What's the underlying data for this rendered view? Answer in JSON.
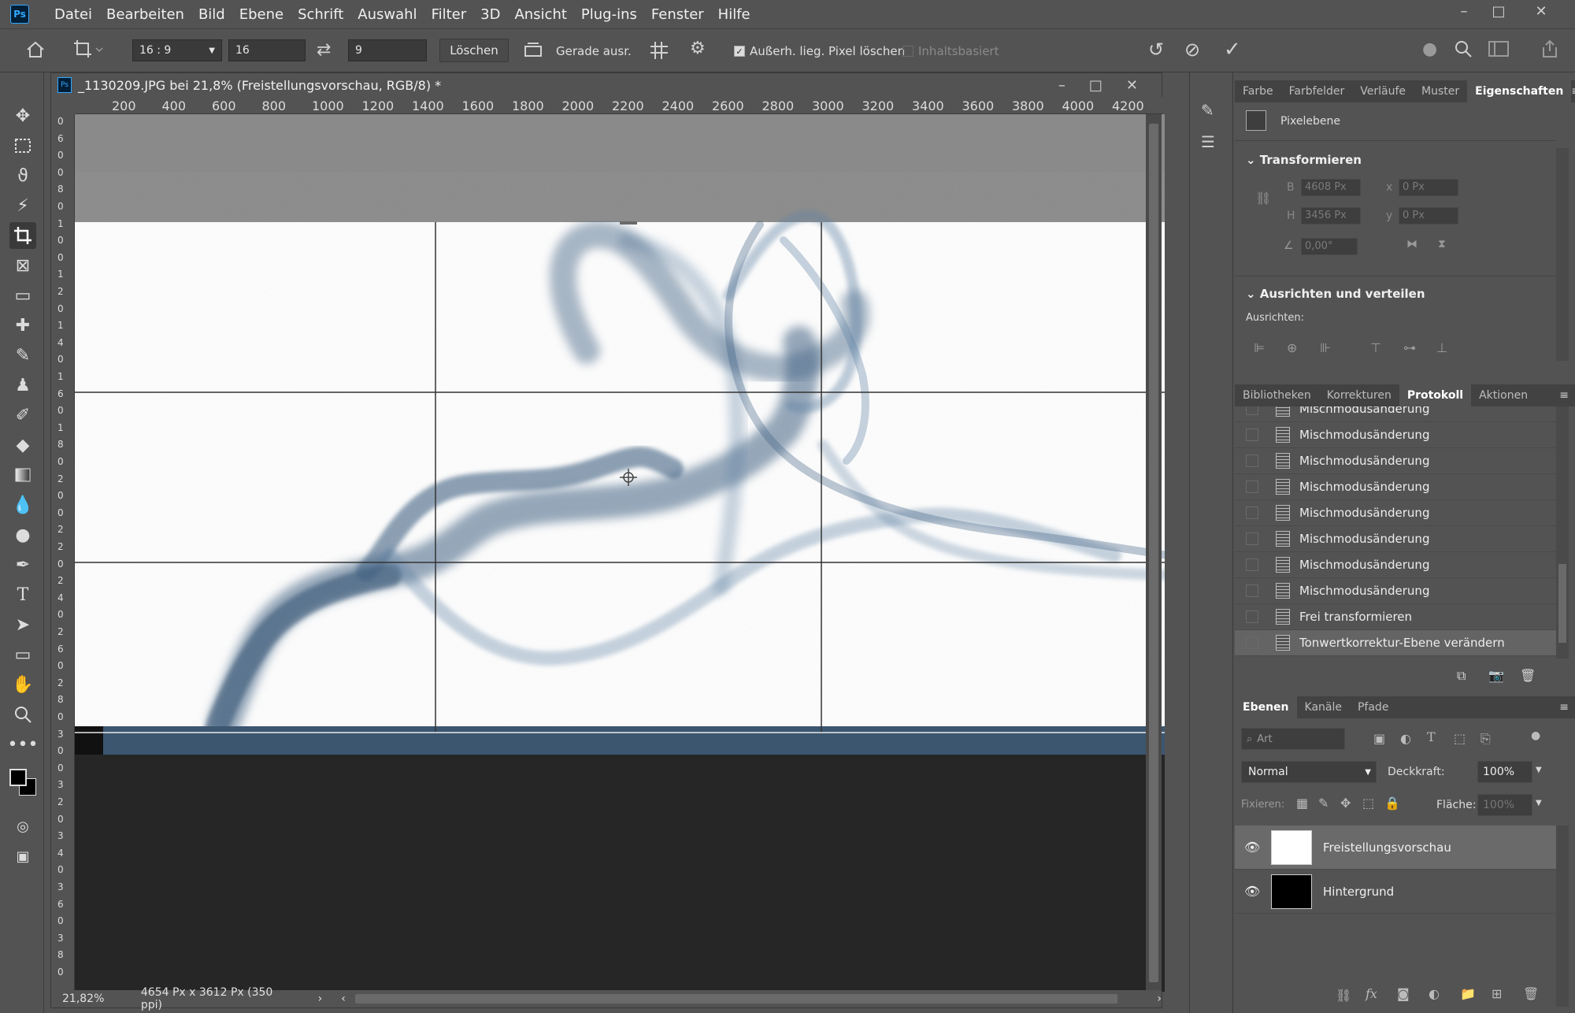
{
  "app": {
    "logo": "Ps"
  },
  "menu": [
    "Datei",
    "Bearbeiten",
    "Bild",
    "Ebene",
    "Schrift",
    "Auswahl",
    "Filter",
    "3D",
    "Ansicht",
    "Plug-ins",
    "Fenster",
    "Hilfe"
  ],
  "window_controls": {
    "minimize": "–",
    "maximize": "□",
    "close": "✕"
  },
  "options": {
    "ratio_select": "16 : 9",
    "width_value": "16",
    "height_value": "9",
    "clear_label": "Löschen",
    "straighten_label": "Gerade ausr.",
    "delete_cropped_label": "Außerh. lieg. Pixel löschen",
    "delete_cropped_checked": true,
    "content_aware_label": "Inhaltsbasiert",
    "content_aware_checked": false
  },
  "document": {
    "title": "_1130209.JPG bei 21,8% (Freistellungsvorschau, RGB/8) *",
    "ruler_h": [
      "200",
      "400",
      "600",
      "800",
      "1000",
      "1200",
      "1400",
      "1600",
      "1800",
      "2000",
      "2200",
      "2400",
      "2600",
      "2800",
      "3000",
      "3200",
      "3400",
      "3600",
      "3800",
      "4000",
      "4200"
    ],
    "ruler_v": [
      "0",
      "6",
      "0",
      "0",
      "8",
      "0",
      "1",
      "0",
      "0",
      "1",
      "2",
      "0",
      "1",
      "4",
      "0",
      "1",
      "6",
      "0",
      "1",
      "8",
      "0",
      "2",
      "0",
      "0",
      "2",
      "2",
      "0",
      "2",
      "4",
      "0",
      "2",
      "6",
      "0",
      "2",
      "8",
      "0",
      "3",
      "0",
      "0",
      "3",
      "2",
      "0",
      "3",
      "4",
      "0",
      "3",
      "6",
      "0",
      "3",
      "8",
      "0"
    ],
    "zoom": "21,82%",
    "dimensions": "4654 Px x 3612 Px (350 ppi)"
  },
  "properties_tabs": [
    "Farbe",
    "Farbfelder",
    "Verläufe",
    "Muster",
    "Eigenschaften"
  ],
  "properties": {
    "layer_type": "Pixelebene",
    "transform_title": "Transformieren",
    "w_label": "B",
    "w_value": "4608 Px",
    "h_label": "H",
    "h_value": "3456 Px",
    "x_label": "x",
    "x_value": "0 Px",
    "y_label": "y",
    "y_value": "0 Px",
    "angle_value": "0,00°",
    "align_title": "Ausrichten und verteilen",
    "align_label": "Ausrichten:"
  },
  "history_tabs": [
    "Bibliotheken",
    "Korrekturen",
    "Protokoll",
    "Aktionen"
  ],
  "history": [
    "Mischmodusänderung",
    "Mischmodusänderung",
    "Mischmodusänderung",
    "Mischmodusänderung",
    "Mischmodusänderung",
    "Mischmodusänderung",
    "Mischmodusänderung",
    "Mischmodusänderung",
    "Frei transformieren",
    "Tonwertkorrektur-Ebene verändern"
  ],
  "layers_tabs": [
    "Ebenen",
    "Kanäle",
    "Pfade"
  ],
  "layers_panel": {
    "filter_placeholder": "Art",
    "blend_mode": "Normal",
    "opacity_label": "Deckkraft:",
    "opacity_value": "100%",
    "lock_label": "Fixieren:",
    "fill_label": "Fläche:",
    "fill_value": "100%"
  },
  "layers": [
    {
      "name": "Freistellungsvorschau",
      "selected": true,
      "visible": true
    },
    {
      "name": "Hintergrund",
      "selected": false,
      "visible": true
    }
  ],
  "colors": {
    "accent": "#31a8ff",
    "smoke": "#3a5d80",
    "panel": "#535353"
  }
}
